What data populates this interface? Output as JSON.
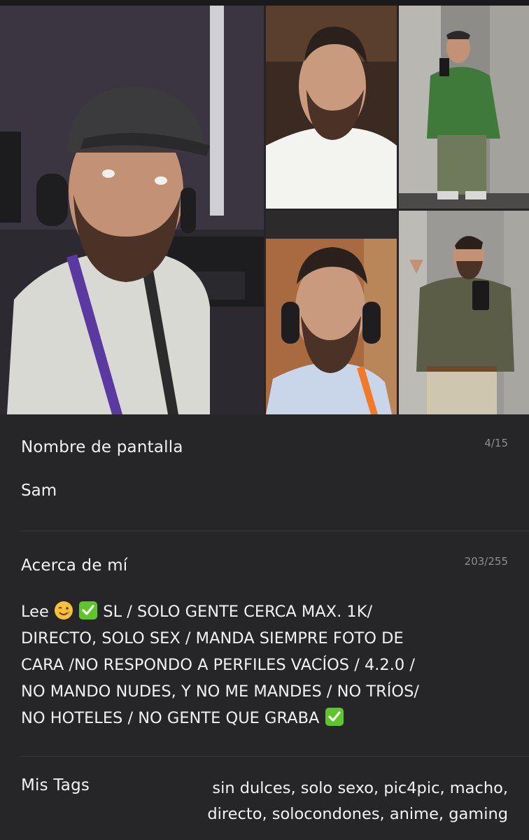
{
  "photos": {
    "icon": "image-icon"
  },
  "screen_name": {
    "label": "Nombre de pantalla",
    "counter": "4/15",
    "value": "Sam"
  },
  "about": {
    "label": "Acerca de mí",
    "counter": "203/255",
    "lines": [
      {
        "before": "Lee ",
        "emoji1": "wink-emoji",
        "emoji2": "check-emoji",
        "after": " SL / SOLO GENTE CERCA MAX. 1K/"
      },
      "DIRECTO, SOLO SEX / MANDA SIEMPRE FOTO DE",
      "CARA /NO RESPONDO A PERFILES VACÍOS / 4.2.0 /",
      "NO MANDO NUDES, Y NO ME MANDES / NO TRÍOS/",
      {
        "text": "NO HOTELES / NO GENTE QUE GRABA ",
        "emoji": "check-emoji"
      }
    ]
  },
  "tags": {
    "label": "Mis Tags",
    "lines": [
      "sin dulces, solo sexo, pic4pic, macho,",
      "directo, solocondones, anime, gaming"
    ]
  },
  "colors": {
    "background": "#262629",
    "check_green": "#5ec52a",
    "wink_yellow": "#f6c13a"
  }
}
